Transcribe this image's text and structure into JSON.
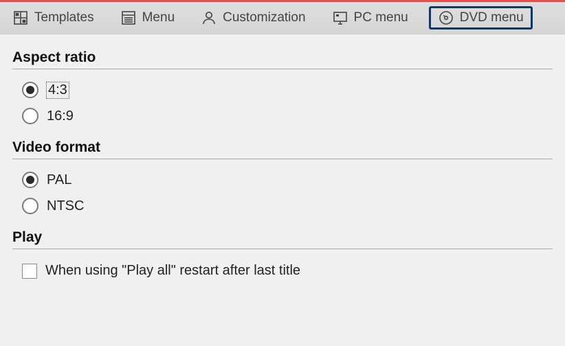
{
  "tabs": {
    "templates": "Templates",
    "menu": "Menu",
    "customization": "Customization",
    "pcmenu": "PC menu",
    "dvdmenu": "DVD menu"
  },
  "sections": {
    "aspect_ratio": {
      "title": "Aspect ratio",
      "options": {
        "r43": "4:3",
        "r169": "16:9"
      },
      "selected": "r43"
    },
    "video_format": {
      "title": "Video format",
      "options": {
        "pal": "PAL",
        "ntsc": "NTSC"
      },
      "selected": "pal"
    },
    "play": {
      "title": "Play",
      "restart_label": "When using \"Play all\" restart after last title",
      "restart_checked": false
    }
  }
}
